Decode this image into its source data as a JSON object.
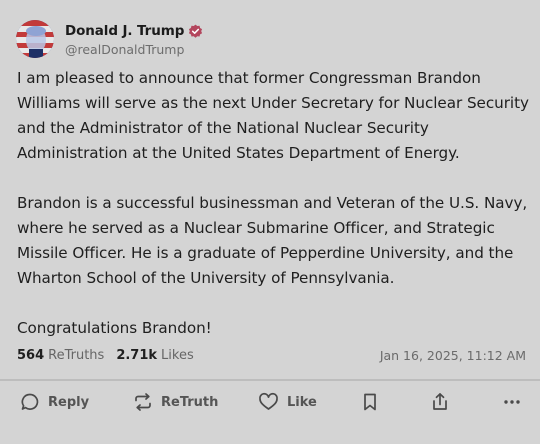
{
  "post": {
    "author": {
      "display_name": "Donald J. Trump",
      "handle": "@realDonaldTrump",
      "verified": true
    },
    "paragraphs": [
      "I am pleased to announce that former Congressman Brandon Williams will serve as the next Under Secretary for Nuclear Security and the Administrator of the National Nuclear Security Administration at the United States Department of Energy.",
      "Brandon is a successful businessman and Veteran of the U.S. Navy, where he served as a Nuclear Submarine Officer, and Strategic Missile Officer. He is a graduate of Pepperdine University, and the Wharton School of the University of Pennsylvania.",
      "Congratulations Brandon!"
    ],
    "stats": {
      "retruths_count": "564",
      "retruths_label": "ReTruths",
      "likes_count": "2.71k",
      "likes_label": "Likes"
    },
    "timestamp": "Jan 16, 2025, 11:12 AM"
  },
  "actions": {
    "reply_label": "Reply",
    "retruth_label": "ReTruth",
    "like_label": "Like"
  },
  "colors": {
    "verified_badge": "#b3465d",
    "background": "#d4d4d4"
  }
}
